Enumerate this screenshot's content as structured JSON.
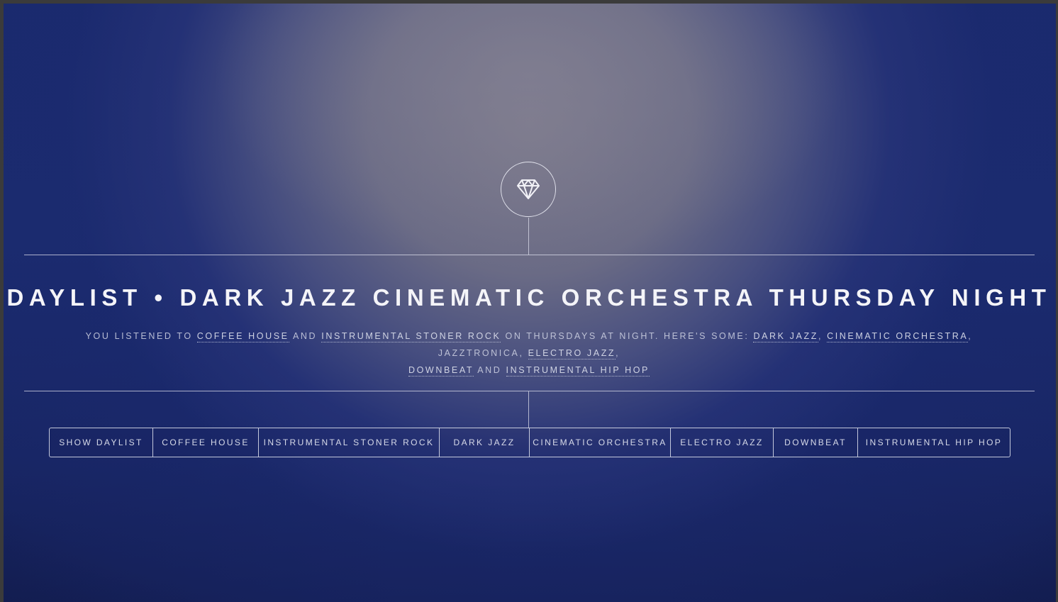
{
  "header": {
    "icon": "diamond-icon",
    "title": "DAYLIST • DARK JAZZ CINEMATIC ORCHESTRA THURSDAY NIGHT"
  },
  "description": {
    "intro": "YOU LISTENED TO ",
    "listened_1": "COFFEE HOUSE",
    "and_1": " AND ",
    "listened_2": "INSTRUMENTAL STONER ROCK",
    "middle": " ON THURSDAYS AT NIGHT. HERE'S SOME: ",
    "genre_1": "DARK JAZZ",
    "sep_1": ", ",
    "genre_2": "CINEMATIC ORCHESTRA",
    "sep_2": ", JAZZTRONICA, ",
    "genre_3": "ELECTRO JAZZ",
    "sep_3": ",",
    "genre_4": "DOWNBEAT",
    "and_2": " AND ",
    "genre_5": "INSTRUMENTAL HIP HOP"
  },
  "buttons": {
    "show_daylist": "SHOW DAYLIST",
    "coffee_house": "COFFEE HOUSE",
    "instrumental_stoner_rock": "INSTRUMENTAL STONER ROCK",
    "dark_jazz": "DARK JAZZ",
    "cinematic_orchestra": "CINEMATIC ORCHESTRA",
    "electro_jazz": "ELECTRO JAZZ",
    "downbeat": "DOWNBEAT",
    "instrumental_hip_hop": "INSTRUMENTAL HIP HOP"
  },
  "colors": {
    "background_blue": "#1b2b6f",
    "spotlight_gray": "#7a788a",
    "text": "#f4f4f8"
  }
}
